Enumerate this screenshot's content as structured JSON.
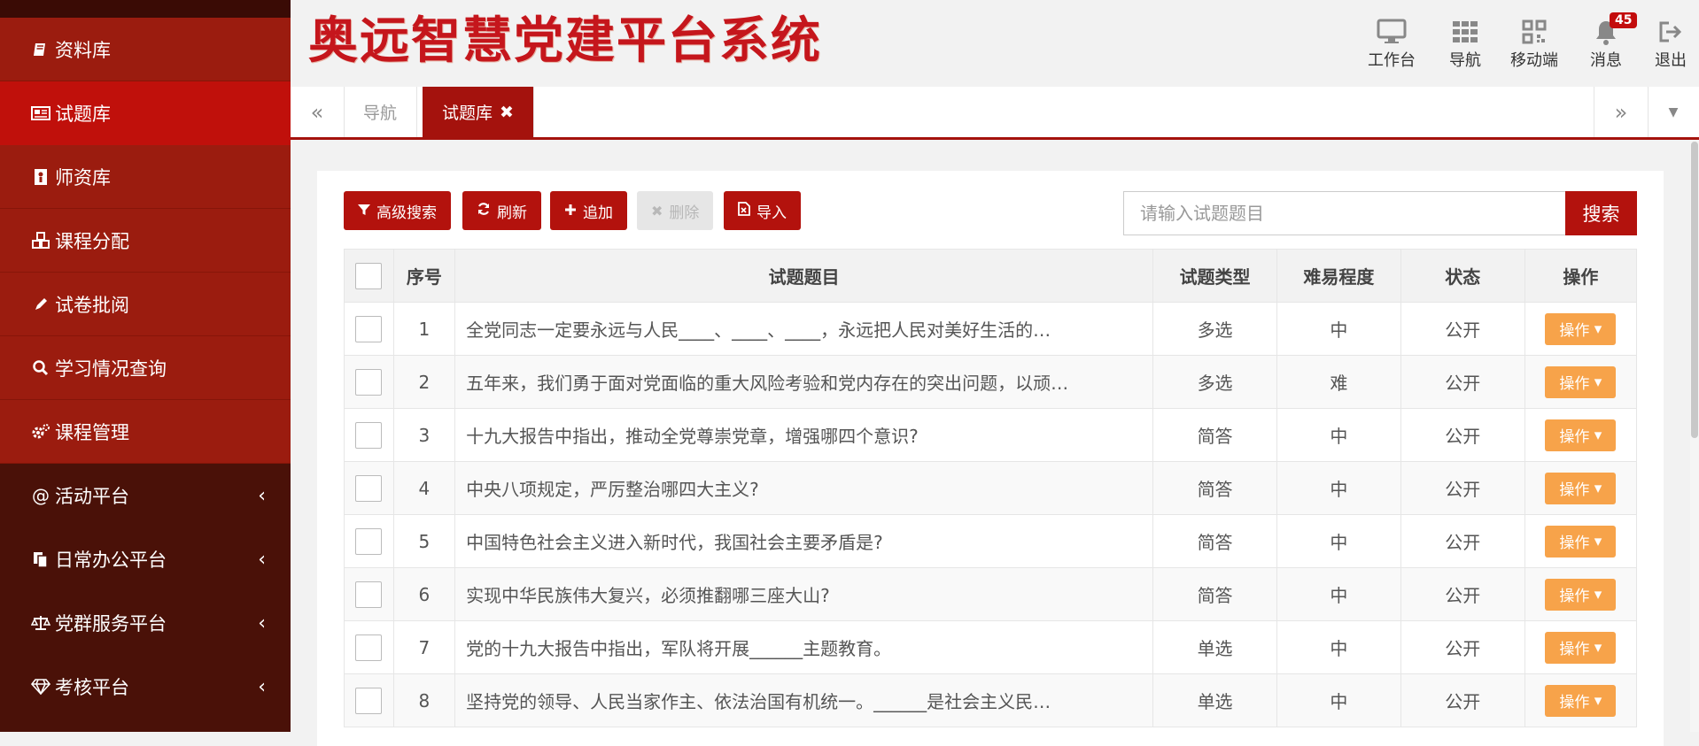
{
  "app": {
    "logo_text": "奥远智慧党建平台系统",
    "accent_color": "#a4120d"
  },
  "sidebar": {
    "items": [
      {
        "label": "资料库",
        "icon": "book-icon",
        "state": "normal"
      },
      {
        "label": "试题库",
        "icon": "newspaper-icon",
        "state": "active"
      },
      {
        "label": "师资库",
        "icon": "id-card-icon",
        "state": "normal"
      },
      {
        "label": "课程分配",
        "icon": "cubes-icon",
        "state": "normal"
      },
      {
        "label": "试卷批阅",
        "icon": "pencil-icon",
        "state": "normal"
      },
      {
        "label": "学习情况查询",
        "icon": "search-icon",
        "state": "normal"
      },
      {
        "label": "课程管理",
        "icon": "gears-icon",
        "state": "normal"
      },
      {
        "label": "活动平台",
        "icon": "at-icon",
        "state": "group"
      },
      {
        "label": "日常办公平台",
        "icon": "files-icon",
        "state": "group"
      },
      {
        "label": "党群服务平台",
        "icon": "balance-scale-icon",
        "state": "group"
      },
      {
        "label": "考核平台",
        "icon": "diamond-icon",
        "state": "group"
      }
    ]
  },
  "header_nav": {
    "workbench": "工作台",
    "navigation": "导航",
    "mobile": "移动端",
    "messages": "消息",
    "messages_count": "45",
    "logout": "退出"
  },
  "tabs": {
    "items": [
      {
        "label": "导航",
        "active": false
      },
      {
        "label": "试题库",
        "active": true
      }
    ]
  },
  "toolbar": {
    "advanced_search": "高级搜索",
    "refresh": "刷新",
    "add": "追加",
    "delete": "删除",
    "import": "导入"
  },
  "search": {
    "placeholder": "请输入试题题目",
    "button": "搜索"
  },
  "table": {
    "columns": [
      "序号",
      "试题题目",
      "试题类型",
      "难易程度",
      "状态",
      "操作"
    ],
    "op_label": "操作",
    "rows": [
      {
        "no": "1",
        "title": "全党同志一定要永远与人民____、____、____，永远把人民对美好生活的…",
        "type": "多选",
        "level": "中",
        "status": "公开"
      },
      {
        "no": "2",
        "title": "五年来，我们勇于面对党面临的重大风险考验和党内存在的突出问题，以顽…",
        "type": "多选",
        "level": "难",
        "status": "公开"
      },
      {
        "no": "3",
        "title": "十九大报告中指出，推动全党尊崇党章，增强哪四个意识?",
        "type": "简答",
        "level": "中",
        "status": "公开"
      },
      {
        "no": "4",
        "title": "中央八项规定，严厉整治哪四大主义?",
        "type": "简答",
        "level": "中",
        "status": "公开"
      },
      {
        "no": "5",
        "title": "中国特色社会主义进入新时代，我国社会主要矛盾是?",
        "type": "简答",
        "level": "中",
        "status": "公开"
      },
      {
        "no": "6",
        "title": "实现中华民族伟大复兴，必须推翻哪三座大山?",
        "type": "简答",
        "level": "中",
        "status": "公开"
      },
      {
        "no": "7",
        "title": "党的十九大报告中指出，军队将开展______主题教育。",
        "type": "单选",
        "level": "中",
        "status": "公开"
      },
      {
        "no": "8",
        "title": "坚持党的领导、人民当家作主、依法治国有机统一。______是社会主义民…",
        "type": "单选",
        "level": "中",
        "status": "公开"
      }
    ]
  }
}
